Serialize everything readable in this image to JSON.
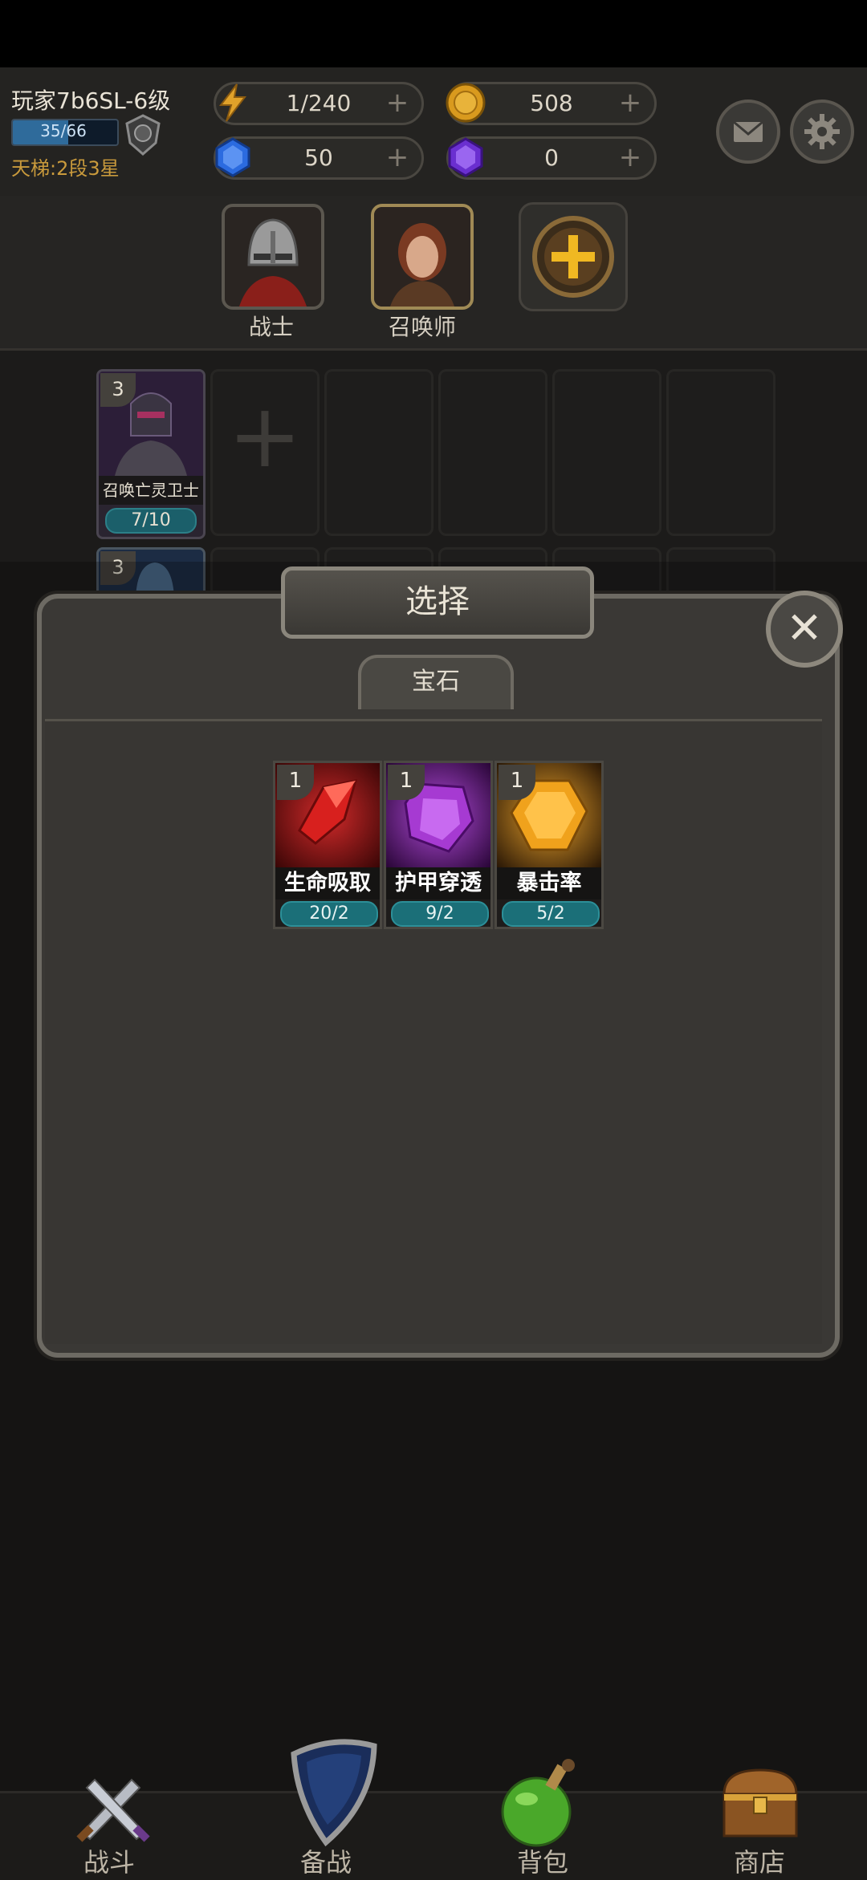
{
  "player": {
    "name": "玩家7b6SL-6级",
    "xp_text": "35/66",
    "xp_fraction": 0.53,
    "ladder": "天梯:2段3星"
  },
  "resources": {
    "energy": "1/240",
    "gold": "508",
    "blue_gem": "50",
    "purple_gem": "0",
    "plus": "+"
  },
  "icons": {
    "energy": "lightning-icon",
    "gold": "coin-icon",
    "blue_gem": "blue-gem-icon",
    "purple_gem": "purple-gem-icon",
    "mail": "mail-icon",
    "settings": "gear-icon"
  },
  "heroes": [
    {
      "label": "战士"
    },
    {
      "label": "召唤师"
    }
  ],
  "skills": {
    "row1": {
      "level": "3",
      "name": "召唤亡灵卫士",
      "count": "7/10"
    },
    "row2": {
      "level": "3"
    },
    "add": "+"
  },
  "dialog": {
    "title": "选择",
    "close": "✕",
    "tab": "宝石",
    "gems": [
      {
        "level": "1",
        "name": "生命吸取",
        "count": "20/2",
        "color": "#b3121c"
      },
      {
        "level": "1",
        "name": "护甲穿透",
        "count": "9/2",
        "color": "#9a2fc4"
      },
      {
        "level": "1",
        "name": "暴击率",
        "count": "5/2",
        "color": "#f0a21c"
      }
    ]
  },
  "nav": [
    {
      "label": "战斗"
    },
    {
      "label": "备战"
    },
    {
      "label": "背包"
    },
    {
      "label": "商店"
    }
  ]
}
